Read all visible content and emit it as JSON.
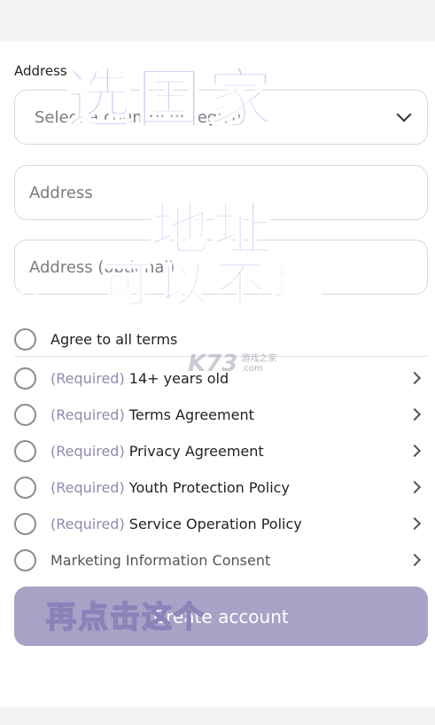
{
  "form": {
    "section_label": "Address",
    "country_select_placeholder": "Select a country or region",
    "address_placeholder": "Address",
    "address2_placeholder": "Address (optional)"
  },
  "agreements": {
    "agree_all_label": "Agree to all terms",
    "items": [
      {
        "required": "(Required)",
        "name": "14+ years old"
      },
      {
        "required": "(Required)",
        "name": "Terms Agreement"
      },
      {
        "required": "(Required)",
        "name": "Privacy Agreement"
      },
      {
        "required": "(Required)",
        "name": "Youth Protection Policy"
      },
      {
        "required": "(Required)",
        "name": "Service Operation Policy"
      },
      {
        "required": "",
        "name": "Marketing Information Consent"
      }
    ]
  },
  "actions": {
    "create_account_label": "Create account"
  },
  "overlay": {
    "line1": "选国家",
    "line2": "地址",
    "line3": "可以不填",
    "hint1": "点击这个",
    "hint2": "再点击这个",
    "logo": "K73",
    "logo_cn": "游戏之家",
    "logo_com": ".com"
  },
  "colors": {
    "button_bg": "#a6a3c6",
    "required_text": "#8e8bb0",
    "field_border": "#d9d9de"
  },
  "icons": [
    "chevron-down-icon",
    "chevron-right-icon",
    "radio-unchecked-icon"
  ]
}
